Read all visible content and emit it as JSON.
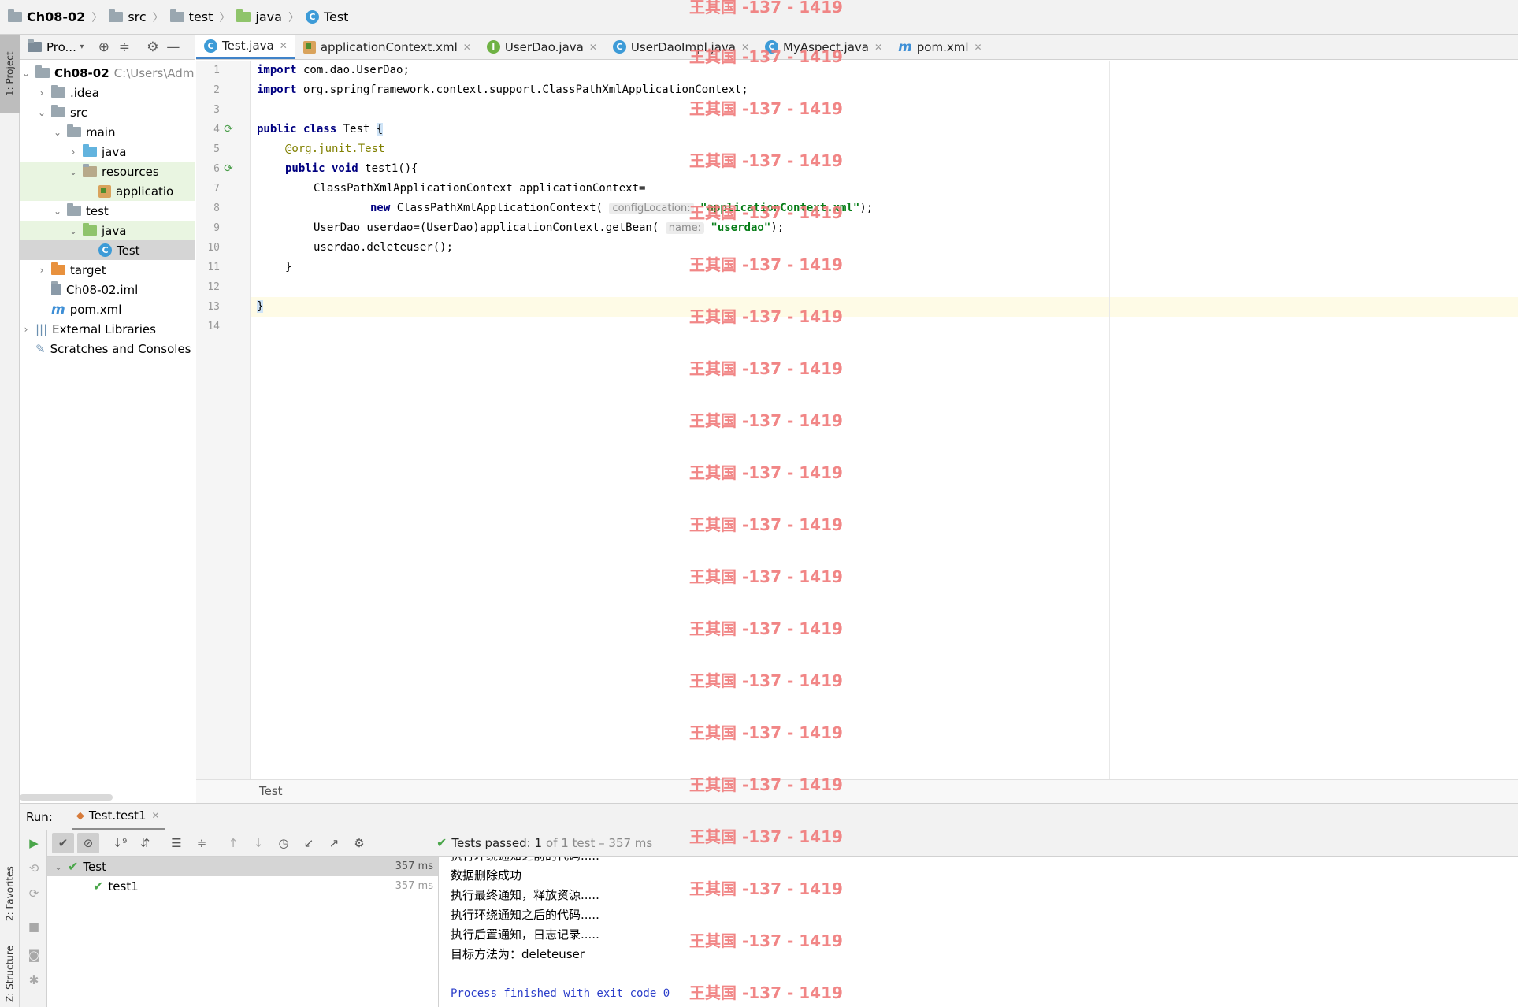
{
  "breadcrumb": [
    "Ch08-02",
    "src",
    "test",
    "java",
    "Test"
  ],
  "project_panel": {
    "title": "Pro...",
    "tree": [
      {
        "label": "Ch08-02",
        "extra": "C:\\Users\\Adm",
        "level": 0,
        "icon": "module-folder-icon",
        "expanded": true
      },
      {
        "label": ".idea",
        "level": 1,
        "icon": "folder-icon",
        "expanded": false
      },
      {
        "label": "src",
        "level": 1,
        "icon": "folder-icon",
        "expanded": true
      },
      {
        "label": "main",
        "level": 2,
        "icon": "folder-icon",
        "expanded": true
      },
      {
        "label": "java",
        "level": 3,
        "icon": "source-folder-icon",
        "expanded": false
      },
      {
        "label": "resources",
        "level": 3,
        "icon": "resources-folder-icon",
        "expanded": true
      },
      {
        "label": "applicatio",
        "level": 4,
        "icon": "xml-file-icon"
      },
      {
        "label": "test",
        "level": 2,
        "icon": "folder-icon",
        "expanded": true
      },
      {
        "label": "java",
        "level": 3,
        "icon": "test-folder-icon",
        "expanded": true
      },
      {
        "label": "Test",
        "level": 4,
        "icon": "class-icon"
      },
      {
        "label": "target",
        "level": 1,
        "icon": "excluded-folder-icon",
        "expanded": false
      },
      {
        "label": "Ch08-02.iml",
        "level": 1,
        "icon": "iml-file-icon"
      },
      {
        "label": "pom.xml",
        "level": 1,
        "icon": "maven-icon"
      },
      {
        "label": "External Libraries",
        "level": 0,
        "icon": "libraries-icon",
        "expanded": false
      },
      {
        "label": "Scratches and Consoles",
        "level": 0,
        "icon": "scratches-icon"
      }
    ]
  },
  "editor_tabs": [
    {
      "label": "Test.java",
      "icon": "class-icon",
      "active": true
    },
    {
      "label": "applicationContext.xml",
      "icon": "xml-file-icon"
    },
    {
      "label": "UserDao.java",
      "icon": "interface-icon"
    },
    {
      "label": "UserDaoImpl.java",
      "icon": "class-icon"
    },
    {
      "label": "MyAspect.java",
      "icon": "class-icon"
    },
    {
      "label": "pom.xml",
      "icon": "maven-icon"
    }
  ],
  "code": {
    "line_numbers": [
      "1",
      "2",
      "3",
      "4",
      "5",
      "6",
      "7",
      "8",
      "9",
      "10",
      "11",
      "12",
      "13",
      "14"
    ],
    "l1_kw": "import",
    "l1_rest": " com.dao.UserDao;",
    "l2_kw": "import",
    "l2_rest": " org.springframework.context.support.ClassPathXmlApplicationContext;",
    "l4_kw": "public class",
    "l4_rest": " Test ",
    "l4_brace": "{",
    "l5_ann": "@org.junit.",
    "l5_ann2": "Test",
    "l6_kw": "public void",
    "l6_rest": " test1(){",
    "l7": "ClassPathXmlApplicationContext applicationContext=",
    "l8_kw": "new",
    "l8_rest": " ClassPathXmlApplicationContext(",
    "l8_hint": "configLocation:",
    "l8_str": "\"applicationContext.xml\"",
    "l8_end": ");",
    "l9_rest": "UserDao userdao=(UserDao)applicationContext.getBean(",
    "l9_hint": "name:",
    "l9_str_open": "\"",
    "l9_str": "userdao",
    "l9_str_close": "\"",
    "l9_end": ");",
    "l10": "userdao.deleteuser();",
    "l11": "}",
    "l13": "}"
  },
  "editor_breadcrumb": "Test",
  "run_panel": {
    "label": "Run:",
    "tab": "Test.test1",
    "status_label": "Tests passed:",
    "status_count": "1",
    "status_rest": "of 1 test – 357 ms",
    "tests": [
      {
        "label": "Test",
        "duration": "357 ms"
      },
      {
        "label": "test1",
        "duration": "357 ms"
      }
    ],
    "console": [
      "执行环绕通知之前的代码.....",
      "数据删除成功",
      "执行最终通知，释放资源.....",
      "执行环绕通知之后的代码.....",
      "执行后置通知，日志记录.....",
      "目标方法为：deleteuser",
      "",
      "Process finished with exit code 0"
    ]
  },
  "side_tabs": {
    "project": "1: Project",
    "favorites": "2: Favorites",
    "structure": "Z: Structure"
  },
  "watermark": "王其国 -137 - 1419"
}
